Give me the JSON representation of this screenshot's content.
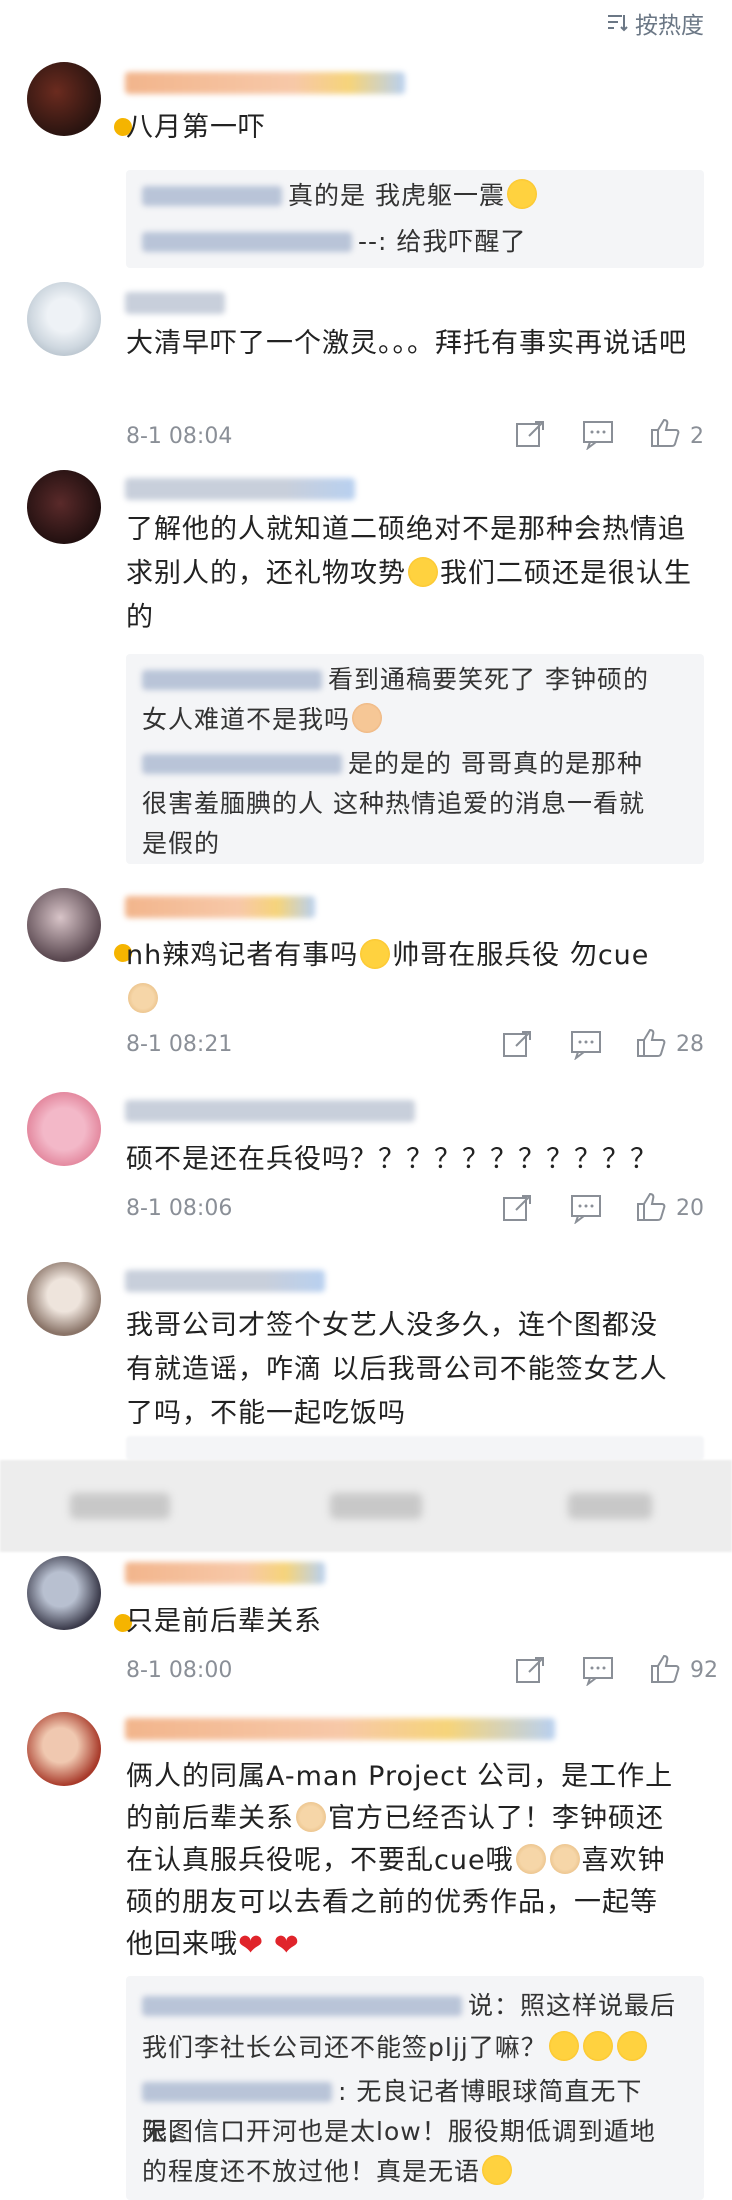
{
  "sort": {
    "label": "按热度"
  },
  "comments": [
    {
      "text": "八月第一吓",
      "replies": [
        {
          "text": "真的是 我虎躯一震"
        },
        {
          "text": "--: 给我吓醒了"
        }
      ]
    },
    {
      "text": "大清早吓了一个激灵。。。拜托有事实再说话吧",
      "time": "8-1 08:04",
      "likes": "2"
    },
    {
      "text_a": "了解他的人就知道二硕绝对不是那种会热情追求别人的，还礼物攻势",
      "text_b": "我们二硕还是很认生的",
      "replies": [
        {
          "text_a": "看到通稿要笑死了 李钟硕的",
          "text_b": "女人难道不是我吗"
        },
        {
          "text_a": "是的是的 哥哥真的是那种",
          "text_b": "很害羞腼腆的人 这种热情追爱的消息一看就",
          "text_c": "是假的"
        }
      ]
    },
    {
      "text_a": "nh辣鸡记者有事吗",
      "text_b": "帅哥在服兵役 勿cue",
      "time": "8-1 08:21",
      "likes": "28"
    },
    {
      "text": "硕不是还在兵役吗？？？？？？？？？？？",
      "time": "8-1 08:06",
      "likes": "20"
    },
    {
      "text_a": "我哥公司才签个女艺人没多久，连个图都没",
      "text_b": "有就造谣，咋滴 以后我哥公司不能签女艺人",
      "text_c": "了吗，不能一起吃饭吗"
    },
    {
      "text": "只是前后辈关系",
      "time": "8-1 08:00",
      "likes": "92"
    },
    {
      "text_a": "俩人的同属A-man Project 公司，是工作上",
      "text_b": "的前后辈关系",
      "text_c": "官方已经否认了！李钟硕还",
      "text_d": "在认真服兵役呢，不要乱cue哦",
      "text_e": "喜欢钟",
      "text_f": "硕的朋友可以去看之前的优秀作品，一起等",
      "text_g": "他回来哦",
      "replies": [
        {
          "text_a": "说：照这样说最后",
          "text_b": "我们李社长公司还不能签pljj了嘛？"
        },
        {
          "text_a": ": 无良记者博眼球简直无下限，",
          "text_b": "无图信口开河也是太low！服役期低调到遁地",
          "text_c": "的程度还不放过他！真是无语"
        }
      ]
    }
  ],
  "colors": {
    "accent": "#e0242b",
    "link": "#6b7785",
    "meta": "#8a8f97",
    "reply_bg": "#f4f5f7"
  },
  "icons": [
    "sort-icon",
    "share-icon",
    "comment-icon",
    "like-icon",
    "heart-icon",
    "emoji-icon"
  ]
}
